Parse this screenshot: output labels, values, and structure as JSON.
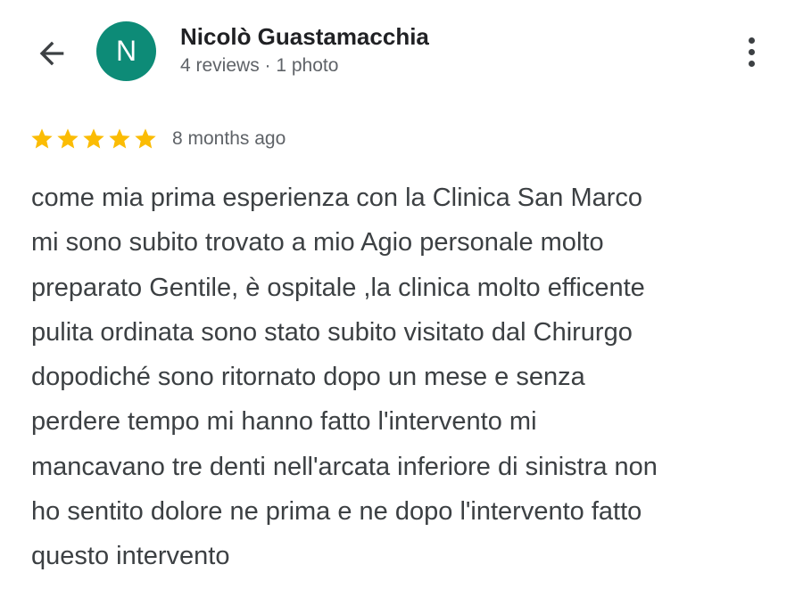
{
  "header": {
    "back_icon": "arrow-back-icon",
    "avatar_letter": "N",
    "avatar_color": "#0d8b77",
    "user_name": "Nicolò Guastamacchia",
    "user_meta": "4 reviews · 1 photo",
    "more_icon": "more-vert-icon"
  },
  "review": {
    "rating": 5,
    "max_rating": 5,
    "star_color": "#fbbc04",
    "date": "8 months ago",
    "text": "come mia prima esperienza con la Clinica San Marco\nmi sono subito trovato a mio Agio personale molto\npreparato Gentile, è ospitale ,la clinica molto efficente\npulita ordinata sono stato subito visitato dal Chirurgo\ndopodiché sono ritornato dopo un mese e senza\nperdere tempo mi hanno fatto l'intervento mi\nmancavano tre denti nell'arcata inferiore di sinistra non\nho sentito dolore ne prima e ne dopo l'intervento fatto\nquesto intervento"
  }
}
